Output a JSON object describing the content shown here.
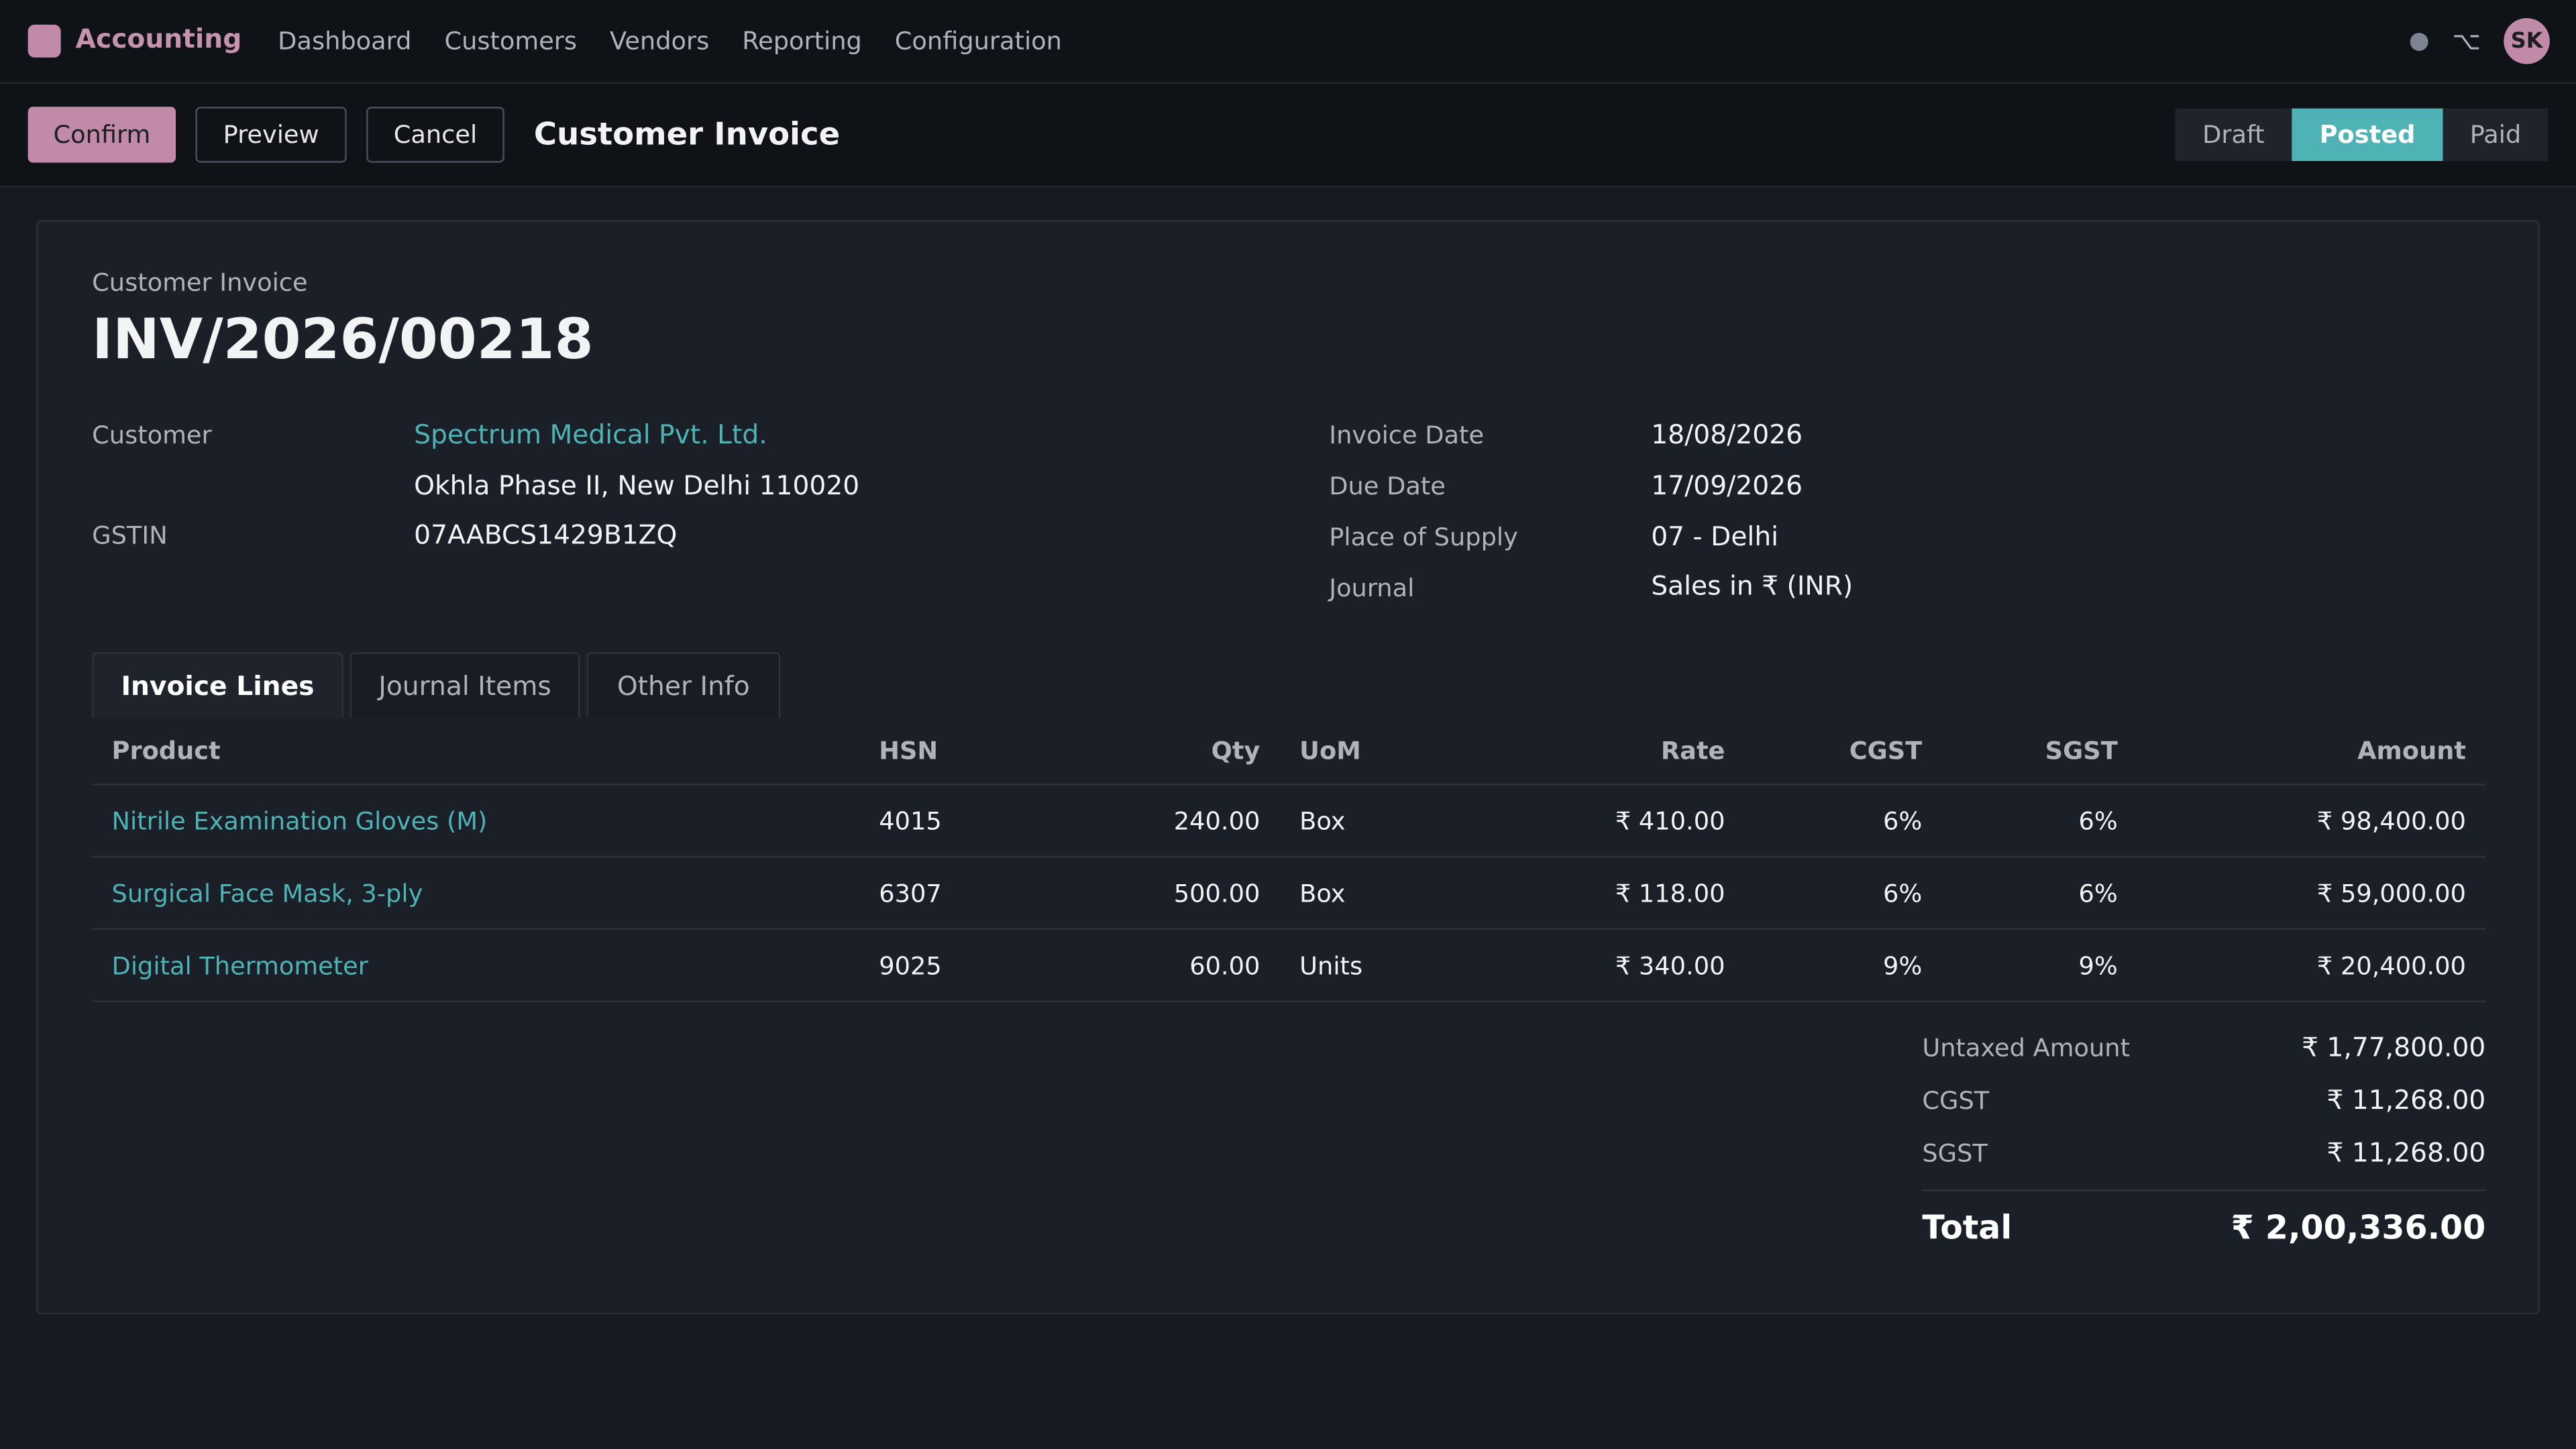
{
  "app": {
    "brand": "Accounting",
    "nav": [
      "Dashboard",
      "Customers",
      "Vendors",
      "Reporting",
      "Configuration"
    ],
    "user_initials": "SK",
    "shortcut_glyph": "⌥"
  },
  "toolbar": {
    "confirm": "Confirm",
    "preview": "Preview",
    "cancel": "Cancel",
    "title": "Customer Invoice"
  },
  "status": {
    "stages": [
      "Draft",
      "Posted",
      "Paid"
    ],
    "current": "Posted"
  },
  "invoice": {
    "doc_type": "Customer Invoice",
    "number": "INV/2026/00218",
    "customer_label": "Customer",
    "customer_name": "Spectrum Medical Pvt. Ltd.",
    "customer_address": "Okhla Phase II, New Delhi 110020",
    "gstin_label": "GSTIN",
    "gstin": "07AABCS1429B1ZQ",
    "invoice_date_label": "Invoice Date",
    "invoice_date": "18/08/2026",
    "due_date_label": "Due Date",
    "due_date": "17/09/2026",
    "place_label": "Place of Supply",
    "place": "07 - Delhi",
    "journal_label": "Journal",
    "journal": "Sales in ₹ (INR)"
  },
  "tabs": [
    "Invoice Lines",
    "Journal Items",
    "Other Info"
  ],
  "lines": {
    "headers": {
      "product": "Product",
      "hsn": "HSN",
      "qty": "Qty",
      "uom": "UoM",
      "rate": "Rate",
      "cgst": "CGST",
      "sgst": "SGST",
      "amount": "Amount"
    },
    "rows": [
      {
        "product": "Nitrile Examination Gloves (M)",
        "hsn": "4015",
        "qty": "240.00",
        "uom": "Box",
        "rate": "₹ 410.00",
        "cgst": "6%",
        "sgst": "6%",
        "amount": "₹ 98,400.00"
      },
      {
        "product": "Surgical Face Mask, 3-ply",
        "hsn": "6307",
        "qty": "500.00",
        "uom": "Box",
        "rate": "₹ 118.00",
        "cgst": "6%",
        "sgst": "6%",
        "amount": "₹ 59,000.00"
      },
      {
        "product": "Digital Thermometer",
        "hsn": "9025",
        "qty": "60.00",
        "uom": "Units",
        "rate": "₹ 340.00",
        "cgst": "9%",
        "sgst": "9%",
        "amount": "₹ 20,400.00"
      }
    ]
  },
  "totals": {
    "untaxed_label": "Untaxed Amount",
    "untaxed": "₹ 1,77,800.00",
    "cgst_label": "CGST",
    "cgst": "₹ 11,268.00",
    "sgst_label": "SGST",
    "sgst": "₹ 11,268.00",
    "total_label": "Total",
    "total": "₹ 2,00,336.00"
  },
  "colors": {
    "accent": "#c08aa8",
    "teal": "#4fb3b6",
    "background": "#161a22"
  }
}
